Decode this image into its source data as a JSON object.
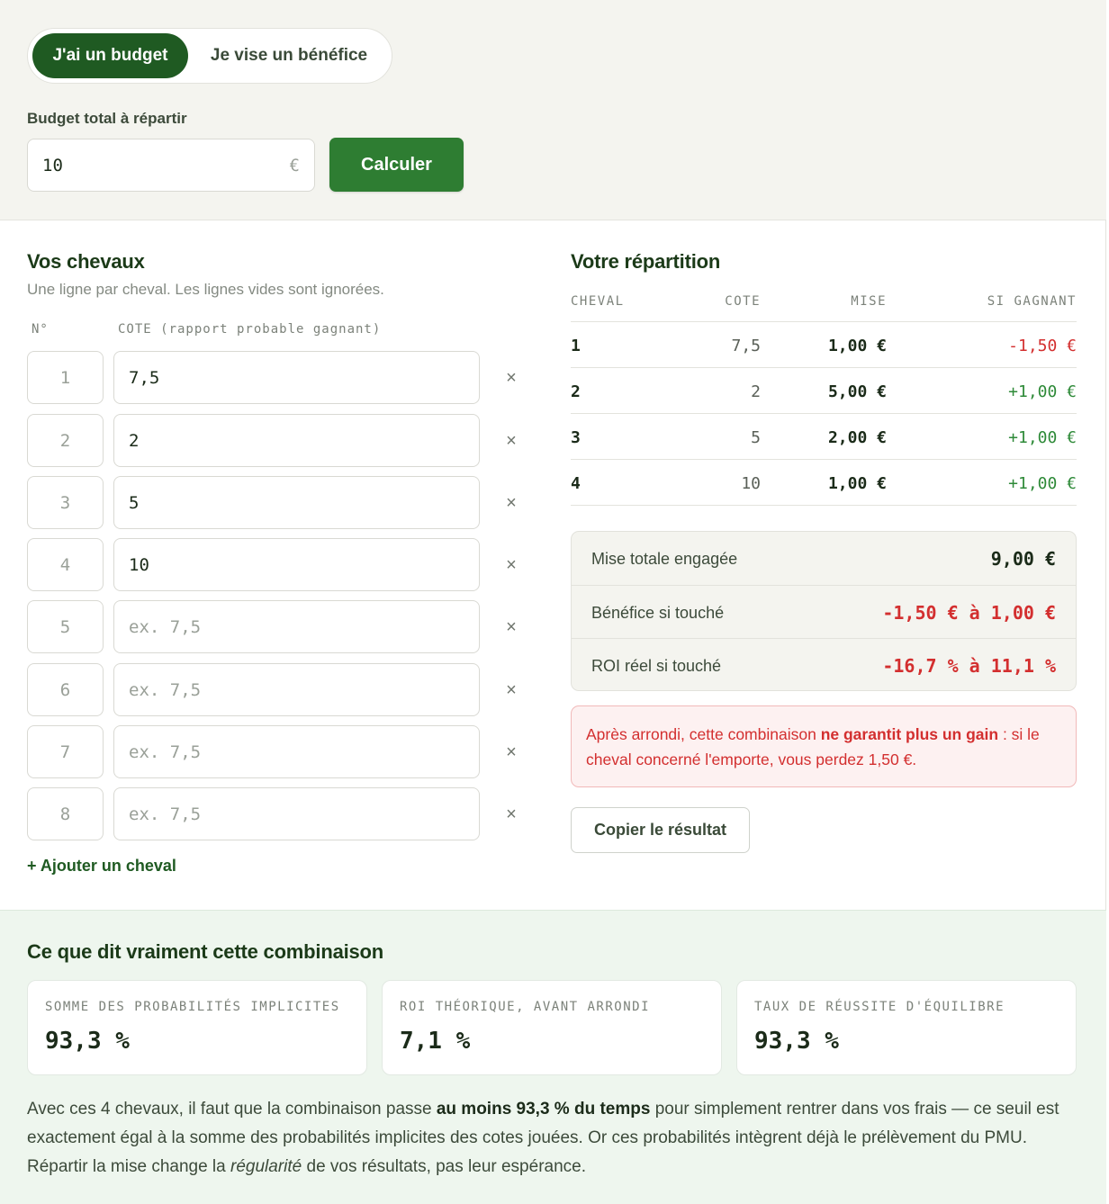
{
  "mode_toggle": {
    "active": "J'ai un budget",
    "inactive": "Je vise un bénéfice"
  },
  "budget": {
    "label": "Budget total à répartir",
    "value": "10",
    "unit": "€",
    "button": "Calculer"
  },
  "horses_panel": {
    "title": "Vos chevaux",
    "subtitle": "Une ligne par cheval. Les lignes vides sont ignorées.",
    "col_num": "N°",
    "col_cote": "COTE (rapport probable gagnant)",
    "placeholder": "ex. 7,5",
    "remove_glyph": "×",
    "rows": [
      {
        "num": "1",
        "cote": "7,5"
      },
      {
        "num": "2",
        "cote": "2"
      },
      {
        "num": "3",
        "cote": "5"
      },
      {
        "num": "4",
        "cote": "10"
      },
      {
        "num": "5",
        "cote": ""
      },
      {
        "num": "6",
        "cote": ""
      },
      {
        "num": "7",
        "cote": ""
      },
      {
        "num": "8",
        "cote": ""
      }
    ],
    "add_link": "+ Ajouter un cheval"
  },
  "repartition": {
    "title": "Votre répartition",
    "headers": [
      "CHEVAL",
      "COTE",
      "MISE",
      "SI GAGNANT"
    ],
    "rows": [
      {
        "cheval": "1",
        "cote": "7,5",
        "mise": "1,00 €",
        "si_gagnant": "-1,50 €",
        "status": "neg"
      },
      {
        "cheval": "2",
        "cote": "2",
        "mise": "5,00 €",
        "si_gagnant": "+1,00 €",
        "status": "pos"
      },
      {
        "cheval": "3",
        "cote": "5",
        "mise": "2,00 €",
        "si_gagnant": "+1,00 €",
        "status": "pos"
      },
      {
        "cheval": "4",
        "cote": "10",
        "mise": "1,00 €",
        "si_gagnant": "+1,00 €",
        "status": "pos"
      }
    ],
    "summary": {
      "mise_label": "Mise totale engagée",
      "mise_value": "9,00 €",
      "benefice_label": "Bénéfice si touché",
      "benefice_value": "-1,50 € à 1,00 €",
      "roi_label": "ROI réel si touché",
      "roi_value": "-16,7 % à 11,1 %"
    },
    "warning": {
      "before": "Après arrondi, cette combinaison ",
      "strong": "ne garantit plus un gain",
      "after": " : si le cheval concerné l'emporte, vous perdez 1,50 €."
    },
    "copy_button": "Copier le résultat"
  },
  "analysis": {
    "title": "Ce que dit vraiment cette combinaison",
    "cards": [
      {
        "label": "SOMME DES PROBABILITÉS IMPLICITES",
        "value": "93,3 %"
      },
      {
        "label": "ROI THÉORIQUE, AVANT ARRONDI",
        "value": "7,1 %"
      },
      {
        "label": "TAUX DE RÉUSSITE D'ÉQUILIBRE",
        "value": "93,3 %"
      }
    ],
    "para_1": "Avec ces 4 chevaux, il faut que la combinaison passe ",
    "para_bold": "au moins 93,3 % du temps",
    "para_2": " pour simplement rentrer dans vos frais — ce seuil est exactement égal à la somme des probabilités implicites des cotes jouées. Or ces probabilités intègrent déjà le prélèvement du PMU. Répartir la mise change la ",
    "para_italic": "régularité",
    "para_3": " de vos résultats, pas leur espérance."
  },
  "colors": {
    "brand_dark": "#1f5a22",
    "brand": "#2e7d32",
    "negative": "#d32f2f",
    "positive": "#2e8a38"
  }
}
